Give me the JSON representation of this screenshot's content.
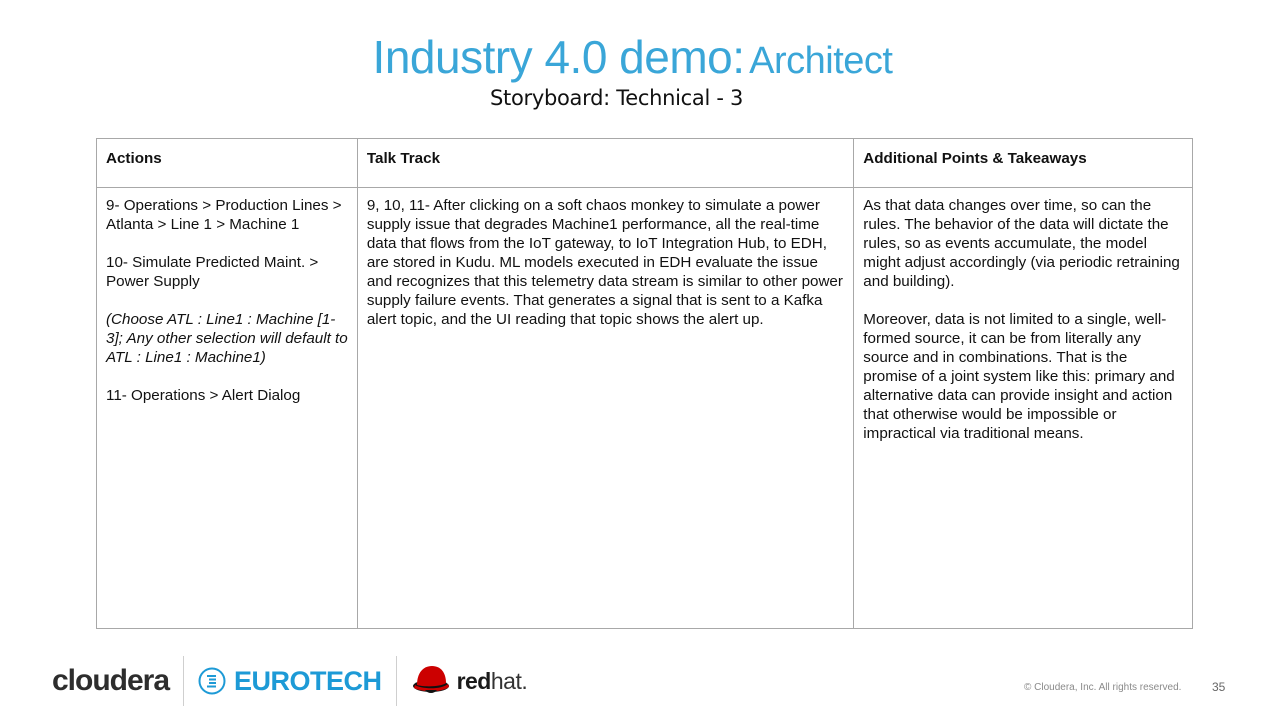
{
  "header": {
    "title_main": "Industry 4.0 demo:",
    "title_sub": "Architect",
    "subtitle": "Storyboard: Technical - 3"
  },
  "table": {
    "columns": [
      "Actions",
      "Talk Track",
      "Additional Points & Takeaways"
    ],
    "actions": [
      {
        "text": "9- Operations > Production Lines > Atlanta > Line 1 > Machine 1",
        "italic": false
      },
      {
        "text": "10- Simulate Predicted Maint. > Power Supply",
        "italic": false
      },
      {
        "text": "(Choose ATL : Line1 : Machine [1-3]; Any other selection will default to ATL : Line1 : Machine1)",
        "italic": true
      },
      {
        "text": "11- Operations > Alert Dialog",
        "italic": false
      }
    ],
    "talk_track": [
      "9, 10, 11- After clicking on a soft chaos monkey to simulate a power supply issue that degrades Machine1 performance, all the real-time data that flows from the IoT gateway, to IoT Integration Hub, to EDH, are stored in Kudu. ML models executed in EDH evaluate the issue and recognizes that this telemetry data stream is similar to other power supply failure events. That generates a signal that is sent to a Kafka alert topic, and the UI reading that topic shows the alert up."
    ],
    "takeaways": [
      "As that data changes over time, so can the rules. The behavior of the data will dictate the rules, so as events accumulate, the model might adjust accordingly (via periodic retraining and building).",
      "Moreover, data is not limited to a single, well-formed source, it can be from literally any source and in combinations. That is the promise of a joint system like this: primary and alternative data can provide insight and action that otherwise would be impossible or impractical via traditional means."
    ]
  },
  "footer": {
    "logos": {
      "cloudera": "cloudera",
      "eurotech": "EUROTECH",
      "redhat_bold": "red",
      "redhat_light": "hat."
    },
    "copyright": "© Cloudera, Inc. All rights reserved.",
    "page_number": "35"
  },
  "colors": {
    "title_blue": "#3aa6d8",
    "eurotech_blue": "#1d9ad6",
    "redhat_red": "#cc0000"
  }
}
